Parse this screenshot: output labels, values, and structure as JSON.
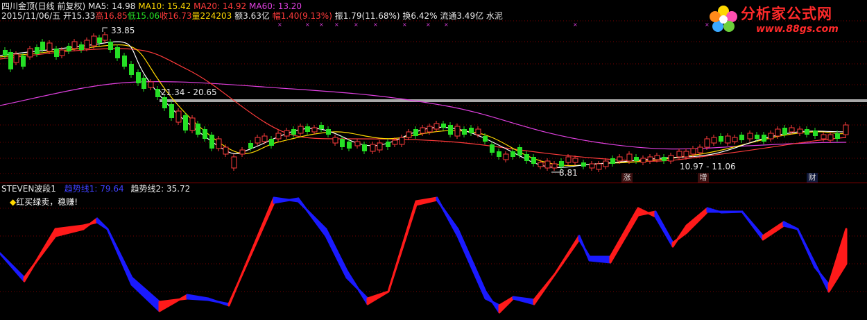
{
  "header": {
    "security": "四川金顶(日线 前复权)",
    "ma5": "MA5: 14.98",
    "ma10": "MA10: 15.42",
    "ma20": "MA20: 14.92",
    "ma60": "MA60: 13.20",
    "date": "2015/11/06/五",
    "open": "开15.33",
    "high": "高16.85",
    "low": "低15.06",
    "close": "收16.73",
    "volume": "量224203",
    "amount": "额3.63亿",
    "change": "幅1.40(9.13%)",
    "amplitude": "振1.79(11.68%)",
    "turnover": "换6.42%",
    "float_cap": "流通3.49亿",
    "sector": "水泥"
  },
  "logo": {
    "name": "分析家公式网",
    "url": "www.88gs.com",
    "icon": "flower-logo-icon"
  },
  "annotations": {
    "high_price": "33.85",
    "range_top": "21.34 - 20.65",
    "low_price": "8.81",
    "range_low": "10.97 - 11.06",
    "badge_rise": "涨",
    "badge_increase": "增",
    "badge_finance": "财"
  },
  "indicator": {
    "name": "STEVEN波段1",
    "trend1": "趋势线1: 79.64",
    "trend2": "趋势线2: 35.72",
    "slogan": "红买绿卖，稳赚!"
  },
  "colors": {
    "bg": "#000000",
    "up": "#ff3b3b",
    "down": "#25e025",
    "ma5": "#ffffff",
    "ma10": "#ffd800",
    "ma20": "#ff3b3b",
    "ma60": "#e040e0",
    "wave_red": "#ff1a1a",
    "wave_blue": "#1a1aff"
  }
}
